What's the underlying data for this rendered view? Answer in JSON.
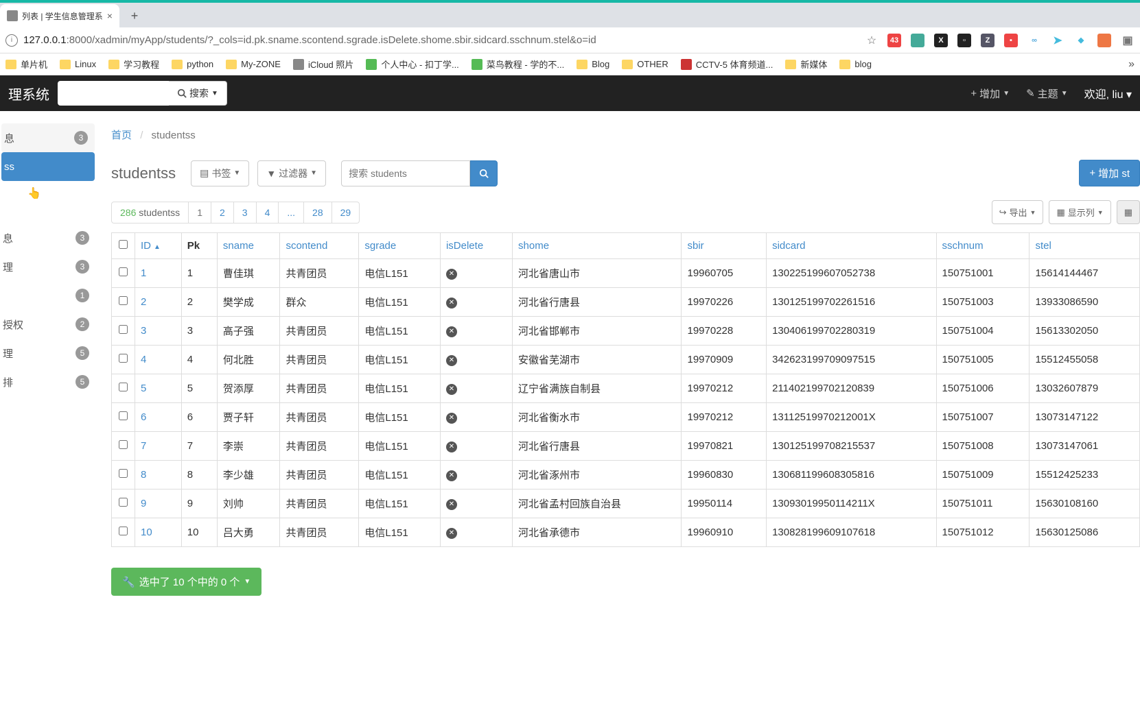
{
  "browser": {
    "tab_title": "列表 | 学生信息管理系",
    "url_host": "127.0.0.1",
    "url_port": ":8000",
    "url_path": "/xadmin/myApp/students/?_cols=id.pk.sname.scontend.sgrade.isDelete.shome.sbir.sidcard.sschnum.stel&o=id",
    "bookmarks": [
      {
        "label": "单片机",
        "type": "folder"
      },
      {
        "label": "Linux",
        "type": "folder"
      },
      {
        "label": "学习教程",
        "type": "folder"
      },
      {
        "label": "python",
        "type": "folder"
      },
      {
        "label": "My-ZONE",
        "type": "folder"
      },
      {
        "label": "iCloud 照片",
        "type": "apple"
      },
      {
        "label": "个人中心 - 扣丁学...",
        "type": "green"
      },
      {
        "label": "菜鸟教程 - 学的不...",
        "type": "runoob"
      },
      {
        "label": "Blog",
        "type": "folder"
      },
      {
        "label": "OTHER",
        "type": "folder"
      },
      {
        "label": "CCTV-5 体育频道...",
        "type": "cctv"
      },
      {
        "label": "新媒体",
        "type": "folder"
      },
      {
        "label": "blog",
        "type": "folder"
      }
    ]
  },
  "app": {
    "title": "理系统",
    "search_button": "搜索",
    "top_add": "增加",
    "top_theme": "主题",
    "welcome_prefix": "欢迎,",
    "welcome_user": "liu"
  },
  "sidebar": [
    {
      "label": "息",
      "count": "3",
      "active_group": true
    },
    {
      "label": "ss",
      "selected": true
    },
    {
      "label": "",
      "cursor": true
    },
    {
      "divider": true
    },
    {
      "label": "息",
      "count": "3"
    },
    {
      "label": "理",
      "count": "3"
    },
    {
      "label": "",
      "count": "1"
    },
    {
      "label": "授权",
      "count": "2"
    },
    {
      "label": "理",
      "count": "5"
    },
    {
      "label": "排",
      "count": "5"
    }
  ],
  "breadcrumb": {
    "home": "首页",
    "current": "studentss"
  },
  "page": {
    "heading": "studentss",
    "bookmark_btn": "书签",
    "filter_btn": "过滤器",
    "search_placeholder": "搜索 students",
    "add_btn": "增加 st",
    "count_num": "286",
    "count_label": "studentss",
    "pages": [
      "1",
      "2",
      "3",
      "4",
      "...",
      "28",
      "29"
    ],
    "export_btn": "导出",
    "columns_btn": "显示列",
    "selection_text": "选中了 10 个中的 0 个"
  },
  "table": {
    "headers": [
      "ID",
      "Pk",
      "sname",
      "scontend",
      "sgrade",
      "isDelete",
      "shome",
      "sbir",
      "sidcard",
      "sschnum",
      "stel"
    ],
    "rows": [
      {
        "id": "1",
        "pk": "1",
        "sname": "曹佳琪",
        "scontend": "共青团员",
        "sgrade": "电信L151",
        "shome": "河北省唐山市",
        "sbir": "19960705",
        "sidcard": "130225199607052738",
        "sschnum": "150751001",
        "stel": "15614144467"
      },
      {
        "id": "2",
        "pk": "2",
        "sname": "樊学成",
        "scontend": "群众",
        "sgrade": "电信L151",
        "shome": "河北省行唐县",
        "sbir": "19970226",
        "sidcard": "130125199702261516",
        "sschnum": "150751003",
        "stel": "13933086590"
      },
      {
        "id": "3",
        "pk": "3",
        "sname": "高子强",
        "scontend": "共青团员",
        "sgrade": "电信L151",
        "shome": "河北省邯郸市",
        "sbir": "19970228",
        "sidcard": "130406199702280319",
        "sschnum": "150751004",
        "stel": "15613302050"
      },
      {
        "id": "4",
        "pk": "4",
        "sname": "何北胜",
        "scontend": "共青团员",
        "sgrade": "电信L151",
        "shome": "安徽省芜湖市",
        "sbir": "19970909",
        "sidcard": "342623199709097515",
        "sschnum": "150751005",
        "stel": "15512455058"
      },
      {
        "id": "5",
        "pk": "5",
        "sname": "贺添厚",
        "scontend": "共青团员",
        "sgrade": "电信L151",
        "shome": "辽宁省满族自制县",
        "sbir": "19970212",
        "sidcard": "211402199702120839",
        "sschnum": "150751006",
        "stel": "13032607879"
      },
      {
        "id": "6",
        "pk": "6",
        "sname": "贾子轩",
        "scontend": "共青团员",
        "sgrade": "电信L151",
        "shome": "河北省衡水市",
        "sbir": "19970212",
        "sidcard": "13112519970212001X",
        "sschnum": "150751007",
        "stel": "13073147122"
      },
      {
        "id": "7",
        "pk": "7",
        "sname": "李崇",
        "scontend": "共青团员",
        "sgrade": "电信L151",
        "shome": "河北省行唐县",
        "sbir": "19970821",
        "sidcard": "130125199708215537",
        "sschnum": "150751008",
        "stel": "13073147061"
      },
      {
        "id": "8",
        "pk": "8",
        "sname": "李少雄",
        "scontend": "共青团员",
        "sgrade": "电信L151",
        "shome": "河北省涿州市",
        "sbir": "19960830",
        "sidcard": "130681199608305816",
        "sschnum": "150751009",
        "stel": "15512425233"
      },
      {
        "id": "9",
        "pk": "9",
        "sname": "刘帅",
        "scontend": "共青团员",
        "sgrade": "电信L151",
        "shome": "河北省孟村回族自治县",
        "sbir": "19950114",
        "sidcard": "13093019950114211X",
        "sschnum": "150751011",
        "stel": "15630108160"
      },
      {
        "id": "10",
        "pk": "10",
        "sname": "吕大勇",
        "scontend": "共青团员",
        "sgrade": "电信L151",
        "shome": "河北省承德市",
        "sbir": "19960910",
        "sidcard": "130828199609107618",
        "sschnum": "150751012",
        "stel": "15630125086"
      }
    ]
  }
}
